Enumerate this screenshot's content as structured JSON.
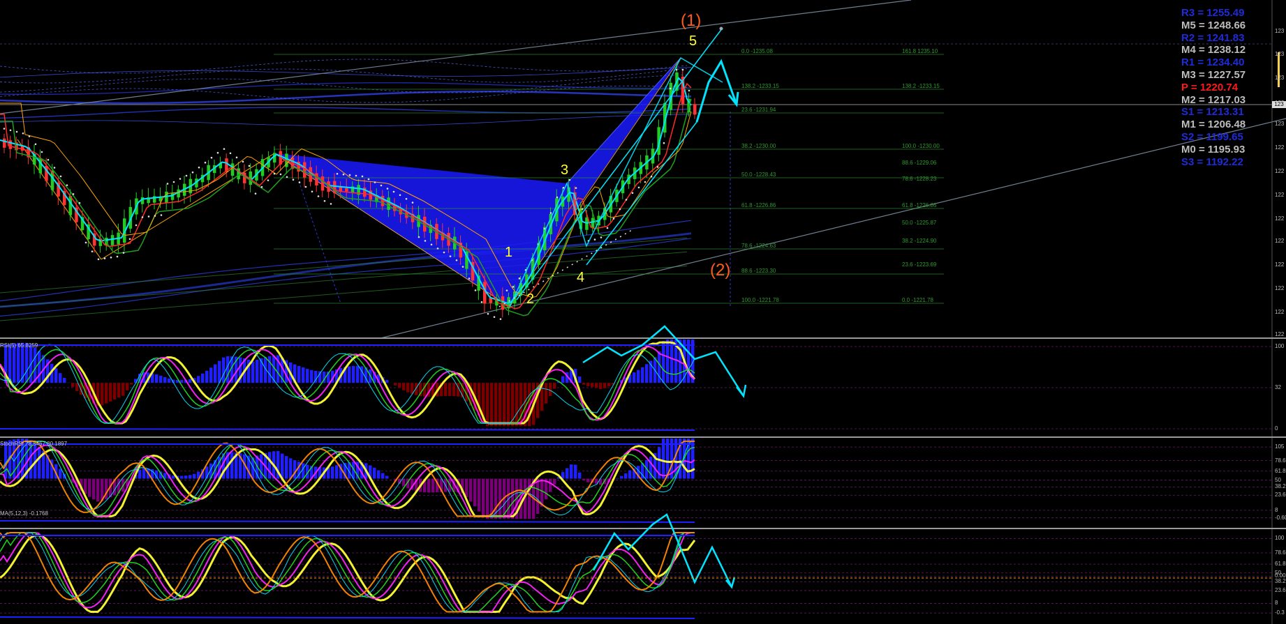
{
  "colors": {
    "background": "#000000",
    "pivot_blue": "#1f2bd9",
    "pivot_gray": "#bdbdbd",
    "pivot_red": "#ff1a1a",
    "cyan": "#00e5ff",
    "yellow": "#ffff33",
    "orange": "#ff5a1a",
    "fib_green": "#2f9a2f",
    "harmonic_blue": "#1a1aff",
    "bull_candle": "#22cc22",
    "bear_candle": "#ff3333"
  },
  "pivots": [
    {
      "label": "R3 = 1255.49",
      "color": "#1f2bd9"
    },
    {
      "label": "M5 = 1248.66",
      "color": "#bdbdbd"
    },
    {
      "label": "R2 = 1241.83",
      "color": "#1f2bd9"
    },
    {
      "label": "M4 = 1238.12",
      "color": "#bdbdbd"
    },
    {
      "label": "R1 = 1234.40",
      "color": "#1f2bd9"
    },
    {
      "label": "M3 = 1227.57",
      "color": "#bdbdbd"
    },
    {
      "label": "P   = 1220.74",
      "color": "#ff1a1a"
    },
    {
      "label": "M2 = 1217.03",
      "color": "#bdbdbd"
    },
    {
      "label": "S1 = 1213.31",
      "color": "#1f2bd9"
    },
    {
      "label": "M1 = 1206.48",
      "color": "#bdbdbd"
    },
    {
      "label": "S2 = 1199.65",
      "color": "#1f2bd9"
    },
    {
      "label": "M0 = 1195.93",
      "color": "#bdbdbd"
    },
    {
      "label": "S3 = 1192.22",
      "color": "#1f2bd9"
    }
  ],
  "wave_labels": {
    "w1": "(1)",
    "w2": "(2)",
    "i1": "1",
    "i2": "2",
    "i3": "3",
    "i4": "4",
    "i5": "5"
  },
  "fib_levels_left": [
    "0.0 -1235.08",
    "138.2 -1233.15",
    "23.6 -1231.94",
    "38.2 -1230.00",
    "50.0 -1228.43",
    "61.8 -1226.86",
    "78.6 -1224.63",
    "88.6 -1223.30",
    "100.0 -1221.78"
  ],
  "fib_levels_right": [
    "161.8 1235.10",
    "138.2 -1233.15",
    "100.0 -1230.00",
    "88.6 -1229.06",
    "78.6 -1228.23",
    "61.8 -1226.86",
    "50.0 -1225.87",
    "38.2 -1224.90",
    "23.6 -1223.69",
    "0.0 -1221.78"
  ],
  "price_axis_ticks": [
    "123",
    "123",
    "123",
    "123",
    "123",
    "122",
    "122",
    "122",
    "122",
    "122",
    "122",
    "122",
    "122",
    "122"
  ],
  "current_price_tag": "123",
  "windows": {
    "rsi": {
      "title": "RSI(5) 65.8259",
      "ticks": [
        "100",
        "32",
        "0"
      ]
    },
    "stochrsi": {
      "title": "StochRSI 78.5467 80.1897",
      "ticks": [
        "105",
        "78.6",
        "61.8",
        "50",
        "38.2",
        "23.6",
        "8",
        "-0.600"
      ]
    },
    "stoch": {
      "title": "MA(5,12,3) -0.1768",
      "ticks": [
        "100",
        "78.6",
        "61.8",
        "50",
        "0.00",
        "38.2",
        "23.6",
        "8",
        "-0.3"
      ]
    }
  }
}
